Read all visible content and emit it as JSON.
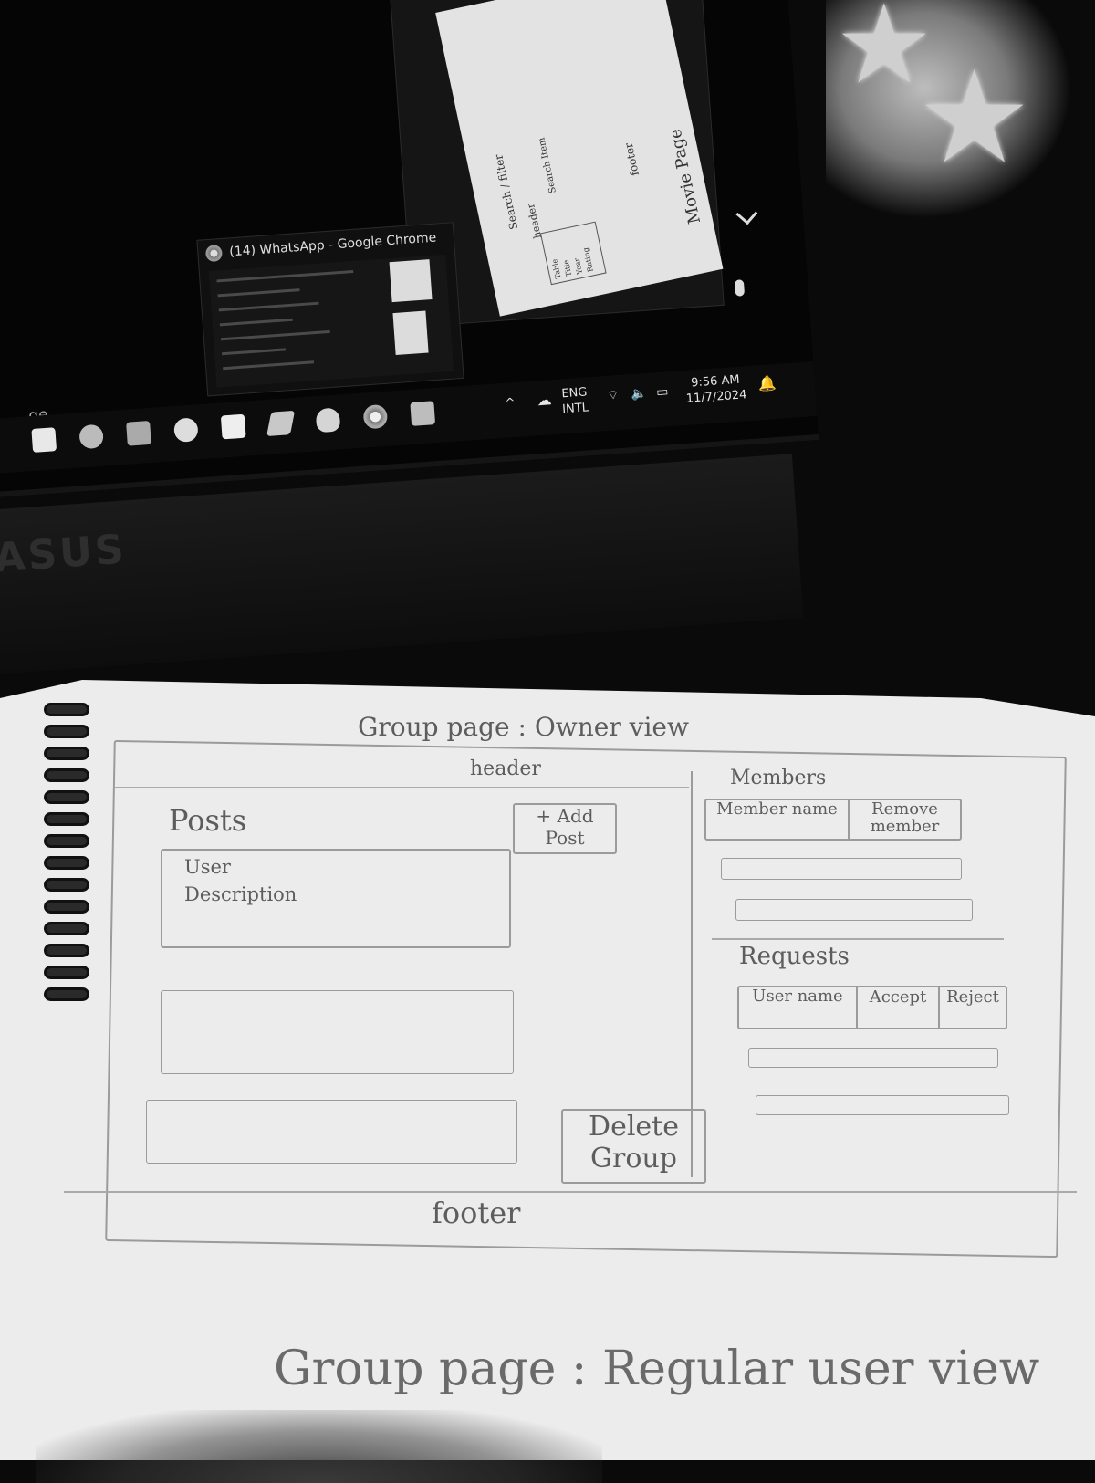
{
  "screen": {
    "left_edge_text": "ge",
    "video_call": {
      "paper_labels": [
        "Search / filter",
        "header",
        "Search Item",
        "footer",
        "Movie Page"
      ],
      "table_cells": [
        "Table",
        "Title",
        "Year",
        "Rating"
      ]
    },
    "whatsapp_preview": {
      "title": "(14) WhatsApp - Google Chrome"
    },
    "tray": {
      "lang_top": "ENG",
      "lang_bottom": "INTL",
      "time": "9:56 AM",
      "date": "11/7/2024"
    },
    "taskbar_icons": [
      "windows-icon",
      "arc-icon",
      "ia-icon",
      "xbox-icon",
      "snip-icon",
      "vscode-icon",
      "postgres-icon",
      "chrome-icon",
      "word-icon"
    ],
    "brand": "ASUS"
  },
  "sketch": {
    "title": "Group page : Owner view",
    "header": "header",
    "posts_label": "Posts",
    "add_post": [
      "+ Add",
      "Post"
    ],
    "post_card": [
      "User",
      "Description"
    ],
    "members": {
      "label": "Members",
      "columns": [
        "Member name",
        "Remove member"
      ]
    },
    "requests": {
      "label": "Requests",
      "columns": [
        "User name",
        "Accept",
        "Reject"
      ]
    },
    "delete_group": [
      "Delete",
      "Group"
    ],
    "footer": "footer"
  },
  "bottom_title": "Group page : Regular user view"
}
